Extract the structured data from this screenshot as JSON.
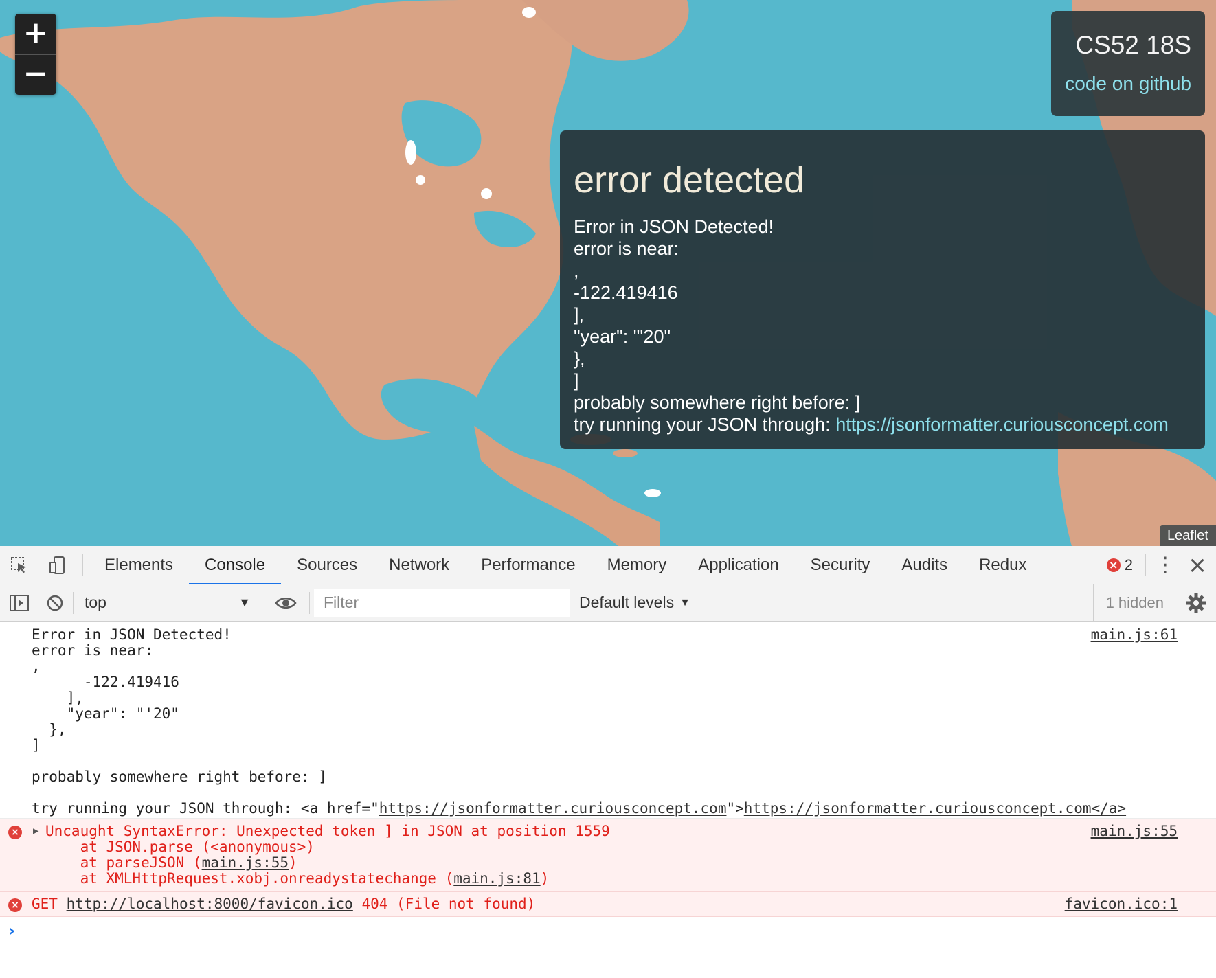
{
  "map": {
    "zoom_in": "+",
    "zoom_out": "−",
    "attribution": "Leaflet"
  },
  "info": {
    "title": "CS52 18S",
    "link": "code on github"
  },
  "error_panel": {
    "title": "error detected",
    "lines": [
      "Error in JSON Detected!",
      "error is near:",
      ",",
      "-122.419416",
      "],",
      "\"year\": \"'20\"",
      "},",
      "]",
      "probably somewhere right before: ]"
    ],
    "try_prefix": "try running your JSON through: ",
    "try_link": "https://jsonformatter.curiousconcept.com"
  },
  "devtools": {
    "tabs": [
      "Elements",
      "Console",
      "Sources",
      "Network",
      "Performance",
      "Memory",
      "Application",
      "Security",
      "Audits",
      "Redux"
    ],
    "active_tab": "Console",
    "error_count": "2",
    "context": "top",
    "filter_placeholder": "Filter",
    "levels": "Default levels",
    "hidden": "1 hidden"
  },
  "console": {
    "log": {
      "source": "main.js:61",
      "lines": [
        "Error in JSON Detected!",
        "error is near:",
        ",",
        "      -122.419416",
        "    ],",
        "    \"year\": \"'20\"",
        "  },",
        "]",
        "",
        "probably somewhere right before: ]",
        ""
      ],
      "try_prefix": "try running your JSON through: <a href=\"",
      "try_url": "https://jsonformatter.curiousconcept.com",
      "try_mid": "\">",
      "try_url2": "https://jsonformatter.curiousconcept.com</a>"
    },
    "error1": {
      "source": "main.js:55",
      "head": "Uncaught SyntaxError: Unexpected token ] in JSON at position 1559",
      "l2": "    at JSON.parse (<anonymous>)",
      "l3_a": "    at parseJSON (",
      "l3_link": "main.js:55",
      "l3_b": ")",
      "l4_a": "    at XMLHttpRequest.xobj.onreadystatechange (",
      "l4_link": "main.js:81",
      "l4_b": ")"
    },
    "error2": {
      "source": "favicon.ico:1",
      "method": "GET ",
      "url": "http://localhost:8000/favicon.ico",
      "status": " 404 (File not found)"
    },
    "prompt": "›"
  }
}
